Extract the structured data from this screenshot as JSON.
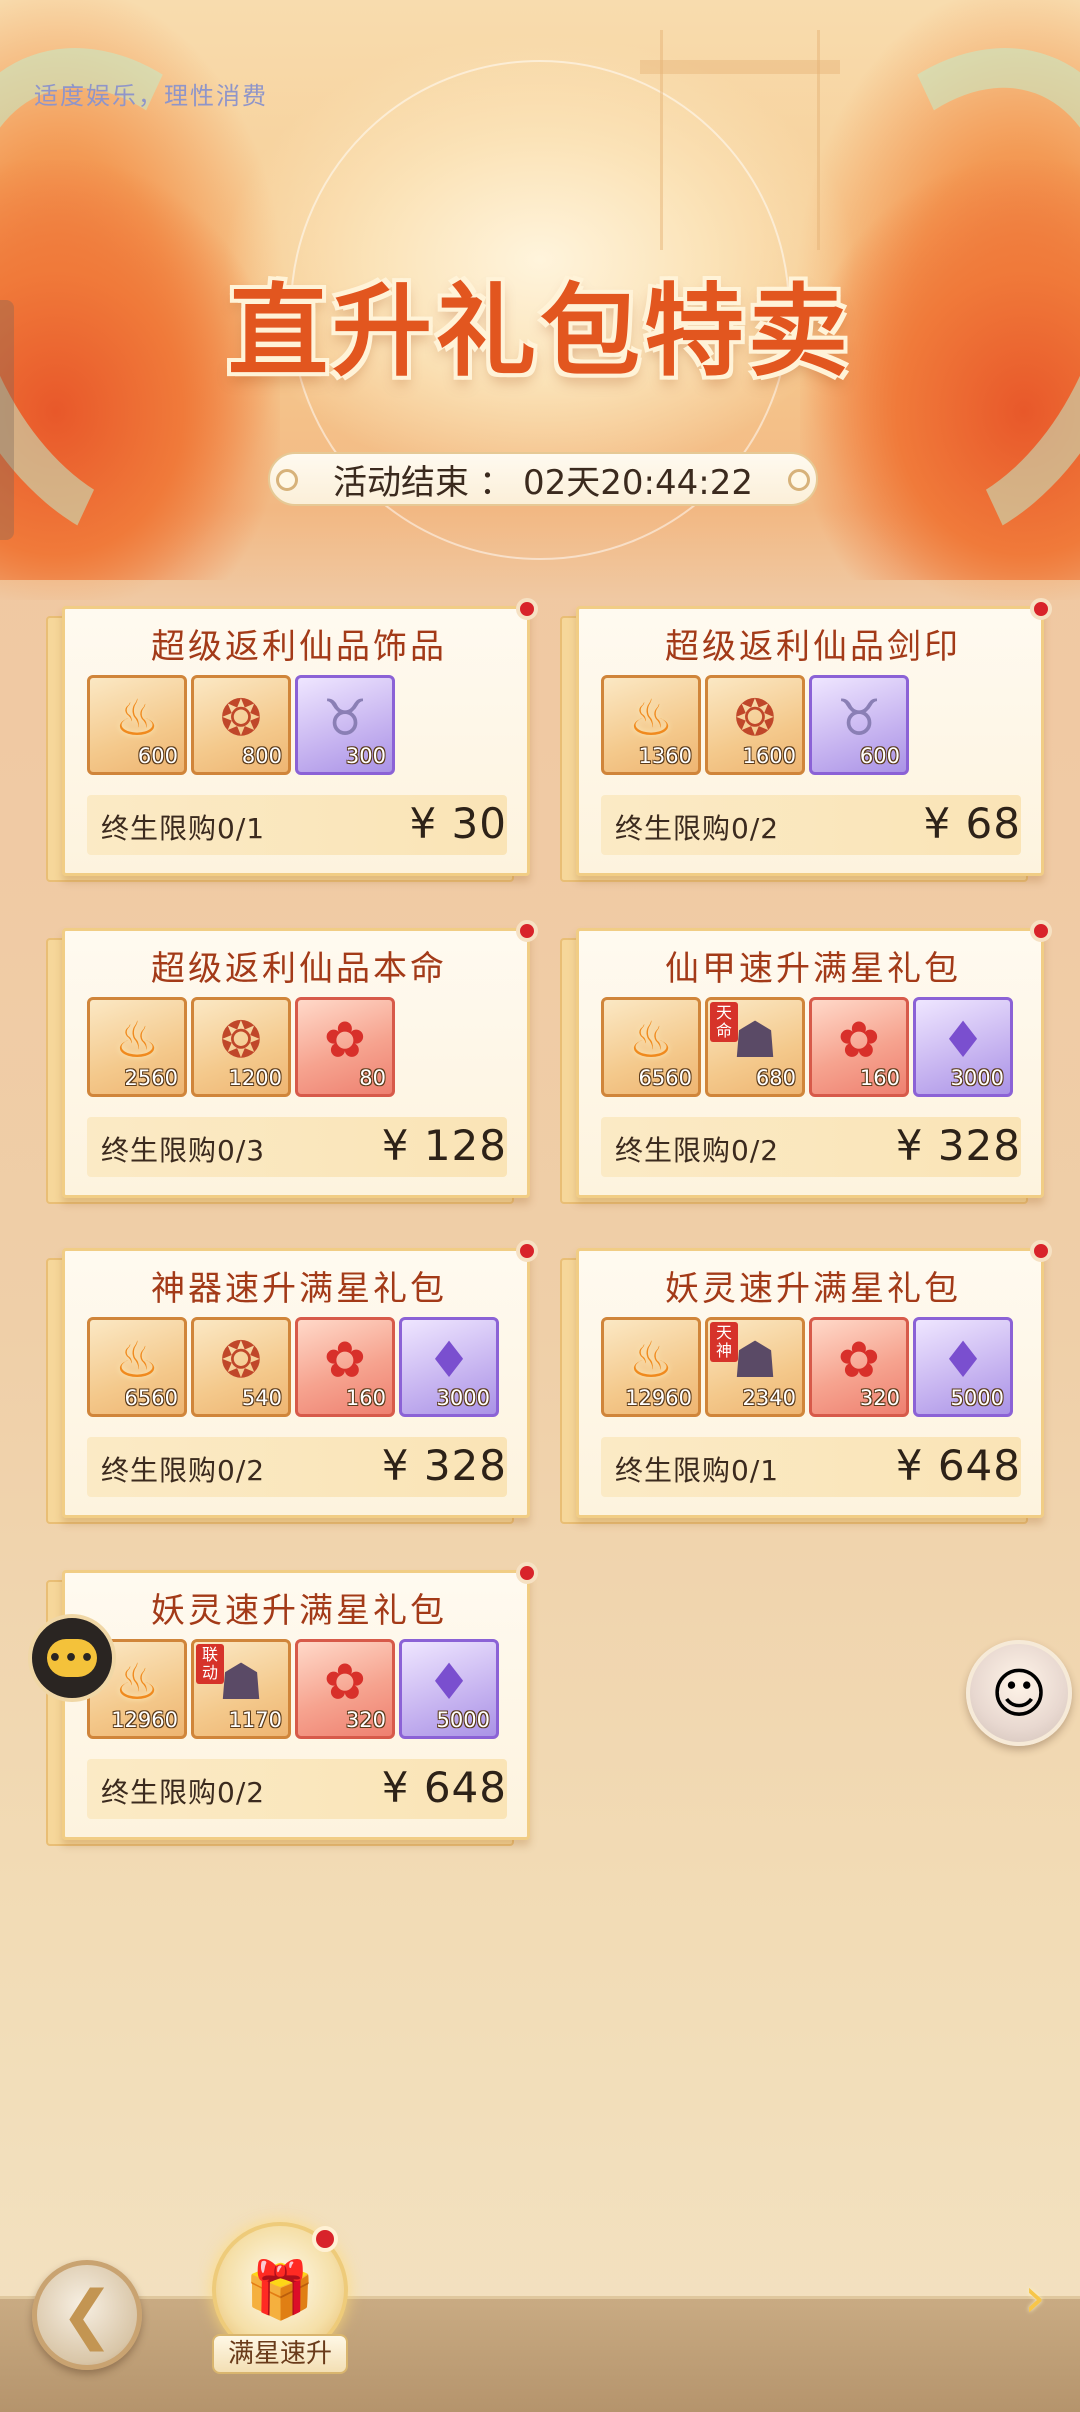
{
  "notice": "适度娱乐，理性消费",
  "title": "直升礼包特卖",
  "timer": {
    "label": "活动结束",
    "separator": "：",
    "value": "02天20:44:22"
  },
  "cards": [
    {
      "title": "超级返利仙品饰品",
      "limit": "终生限购0/1",
      "price": "¥ 30",
      "items": [
        {
          "type": "flame",
          "count": "600"
        },
        {
          "type": "gem",
          "count": "800"
        },
        {
          "type": "ox",
          "count": "300"
        }
      ]
    },
    {
      "title": "超级返利仙品剑印",
      "limit": "终生限购0/2",
      "price": "¥ 68",
      "items": [
        {
          "type": "flame",
          "count": "1360"
        },
        {
          "type": "gem",
          "count": "1600"
        },
        {
          "type": "ox",
          "count": "600"
        }
      ]
    },
    {
      "title": "超级返利仙品本命",
      "limit": "终生限购0/3",
      "price": "¥ 128",
      "items": [
        {
          "type": "flame",
          "count": "2560"
        },
        {
          "type": "gem",
          "count": "1200"
        },
        {
          "type": "rose",
          "count": "80"
        }
      ]
    },
    {
      "title": "仙甲速升满星礼包",
      "limit": "终生限购0/2",
      "price": "¥ 328",
      "items": [
        {
          "type": "flame",
          "count": "6560"
        },
        {
          "type": "char",
          "count": "680",
          "tag": "天命"
        },
        {
          "type": "rose",
          "count": "160"
        },
        {
          "type": "crystal",
          "count": "3000"
        }
      ]
    },
    {
      "title": "神器速升满星礼包",
      "limit": "终生限购0/2",
      "price": "¥ 328",
      "items": [
        {
          "type": "flame",
          "count": "6560"
        },
        {
          "type": "gem",
          "count": "540"
        },
        {
          "type": "rose",
          "count": "160"
        },
        {
          "type": "crystal",
          "count": "3000"
        }
      ]
    },
    {
      "title": "妖灵速升满星礼包",
      "limit": "终生限购0/1",
      "price": "¥ 648",
      "items": [
        {
          "type": "flame",
          "count": "12960"
        },
        {
          "type": "char",
          "count": "2340",
          "tag": "天神"
        },
        {
          "type": "rose",
          "count": "320"
        },
        {
          "type": "crystal",
          "count": "5000"
        }
      ]
    },
    {
      "title": "妖灵速升满星礼包",
      "limit": "终生限购0/2",
      "price": "¥ 648",
      "items": [
        {
          "type": "flame",
          "count": "12960"
        },
        {
          "type": "char",
          "count": "1170",
          "tag": "联动"
        },
        {
          "type": "rose",
          "count": "320"
        },
        {
          "type": "crystal",
          "count": "5000"
        }
      ]
    }
  ],
  "icons": {
    "flame": "flame-icon",
    "gem": "ornament-icon",
    "ox": "ox-icon",
    "rose": "rose-icon",
    "crystal": "crystal-icon",
    "char": "character-icon",
    "chat": "chat-icon",
    "avatar": "avatar-icon",
    "back": "back-arrow-icon",
    "next": "next-arrow-icon",
    "tab": "upgrade-tab-icon"
  },
  "colors": {
    "accent": "#e2561f",
    "title_text": "#a33a18",
    "badge": "#d8232a",
    "purple_rarity": "#8b62d6",
    "red_rarity": "#d75a4a"
  },
  "bottom": {
    "tab_label": "满星速升",
    "chat_text": "•••"
  }
}
